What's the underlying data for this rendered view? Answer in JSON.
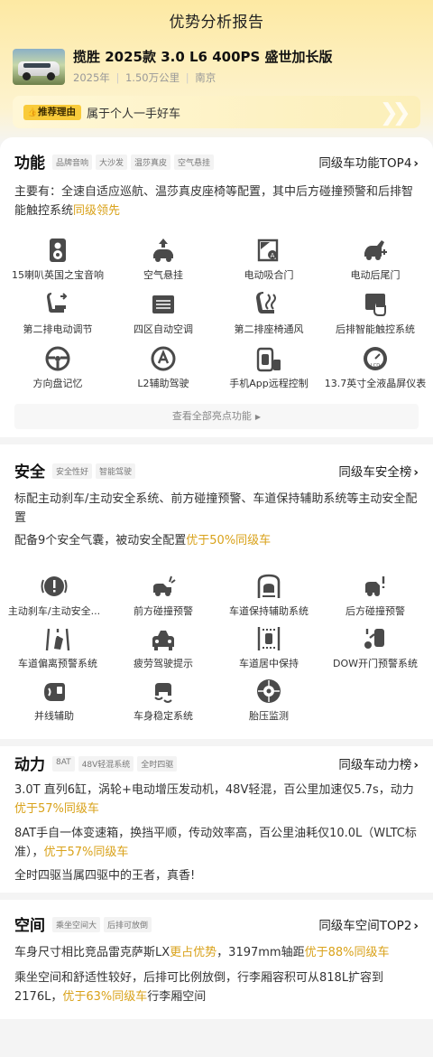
{
  "page_title": "优势分析报告",
  "car": {
    "name": "揽胜 2025款 3.0 L6 400PS 盛世加长版",
    "year": "2025年",
    "mileage": "1.50万公里",
    "city": "南京",
    "sep": "|"
  },
  "reason": {
    "tag": "推荐理由",
    "text": "属于个人一手好车"
  },
  "function": {
    "title": "功能",
    "chips": [
      "品牌音响",
      "大沙发",
      "温莎真皮",
      "空气悬挂"
    ],
    "rank": "同级车功能TOP4",
    "desc_main": "主要有：全速自适应巡航、温莎真皮座椅等配置，其中后方碰撞预警和后排智能触控系统",
    "desc_hl": "同级领先",
    "features": [
      {
        "label": "15喇叭英国之宝音响",
        "icon": "speaker-icon"
      },
      {
        "label": "空气悬挂",
        "icon": "air-suspension-icon"
      },
      {
        "label": "电动吸合门",
        "icon": "soft-close-door-icon"
      },
      {
        "label": "电动后尾门",
        "icon": "power-tailgate-icon"
      },
      {
        "label": "第二排电动调节",
        "icon": "seat-adjust-icon"
      },
      {
        "label": "四区自动空调",
        "icon": "climate-icon"
      },
      {
        "label": "第二排座椅通风",
        "icon": "seat-ventilation-icon"
      },
      {
        "label": "后排智能触控系统",
        "icon": "touch-control-icon"
      },
      {
        "label": "方向盘记忆",
        "icon": "steering-memory-icon"
      },
      {
        "label": "L2辅助驾驶",
        "icon": "assisted-driving-icon"
      },
      {
        "label": "手机App远程控制",
        "icon": "remote-app-icon"
      },
      {
        "label": "13.7英寸全液晶屏仪表",
        "icon": "lcd-cluster-icon"
      }
    ],
    "more": "查看全部亮点功能"
  },
  "safety": {
    "title": "安全",
    "chips": [
      "安全性好",
      "智能驾驶"
    ],
    "rank": "同级车安全榜",
    "desc1": "标配主动刹车/主动安全系统、前方碰撞预警、车道保持辅助系统等主动安全配置",
    "desc2_main": "配备9个安全气囊，被动安全配置",
    "desc2_hl": "优于50%同级车",
    "features": [
      {
        "label": "主动刹车/主动安全...",
        "icon": "auto-brake-icon"
      },
      {
        "label": "前方碰撞预警",
        "icon": "front-collision-icon"
      },
      {
        "label": "车道保持辅助系统",
        "icon": "lane-keep-icon"
      },
      {
        "label": "后方碰撞预警",
        "icon": "rear-collision-icon"
      },
      {
        "label": "车道偏离预警系统",
        "icon": "lane-departure-icon"
      },
      {
        "label": "疲劳驾驶提示",
        "icon": "fatigue-icon"
      },
      {
        "label": "车道居中保持",
        "icon": "lane-center-icon"
      },
      {
        "label": "DOW开门预警系统",
        "icon": "dow-icon"
      },
      {
        "label": "并线辅助",
        "icon": "blind-spot-icon"
      },
      {
        "label": "车身稳定系统",
        "icon": "stability-icon"
      },
      {
        "label": "胎压监测",
        "icon": "tire-pressure-icon"
      }
    ]
  },
  "power": {
    "title": "动力",
    "chips": [
      "8AT",
      "48V轻混系统",
      "全时四驱"
    ],
    "rank": "同级车动力榜",
    "desc1_main": "3.0T 直列6缸，涡轮+电动增压发动机，48V轻混，百公里加速仅5.7s，动力",
    "desc1_hl": "优于57%同级车",
    "desc2_main": "8AT手自一体变速箱，换挡平顺，传动效率高，百公里油耗仅10.0L（WLTC标准），",
    "desc2_hl": "优于57%同级车",
    "desc3": "全时四驱当属四驱中的王者，真香!"
  },
  "space": {
    "title": "空间",
    "chips": [
      "乘坐空间大",
      "后排可放倒"
    ],
    "rank": "同级车空间TOP2",
    "desc1_a": "车身尺寸相比竞品雷克萨斯LX",
    "desc1_hl1": "更占优势",
    "desc1_b": "，3197mm轴距",
    "desc1_hl2": "优于88%同级车",
    "desc2_main": "乘坐空间和舒适性较好，后排可比例放倒，行李厢容积可从818L扩容到2176L，",
    "desc2_hl": "优于63%同级车",
    "desc2_tail": "行李厢空间"
  },
  "colors": {
    "accent": "#d9a21a",
    "tag_bg": "#f9cb3a",
    "header_bg": "#fde9a3"
  }
}
